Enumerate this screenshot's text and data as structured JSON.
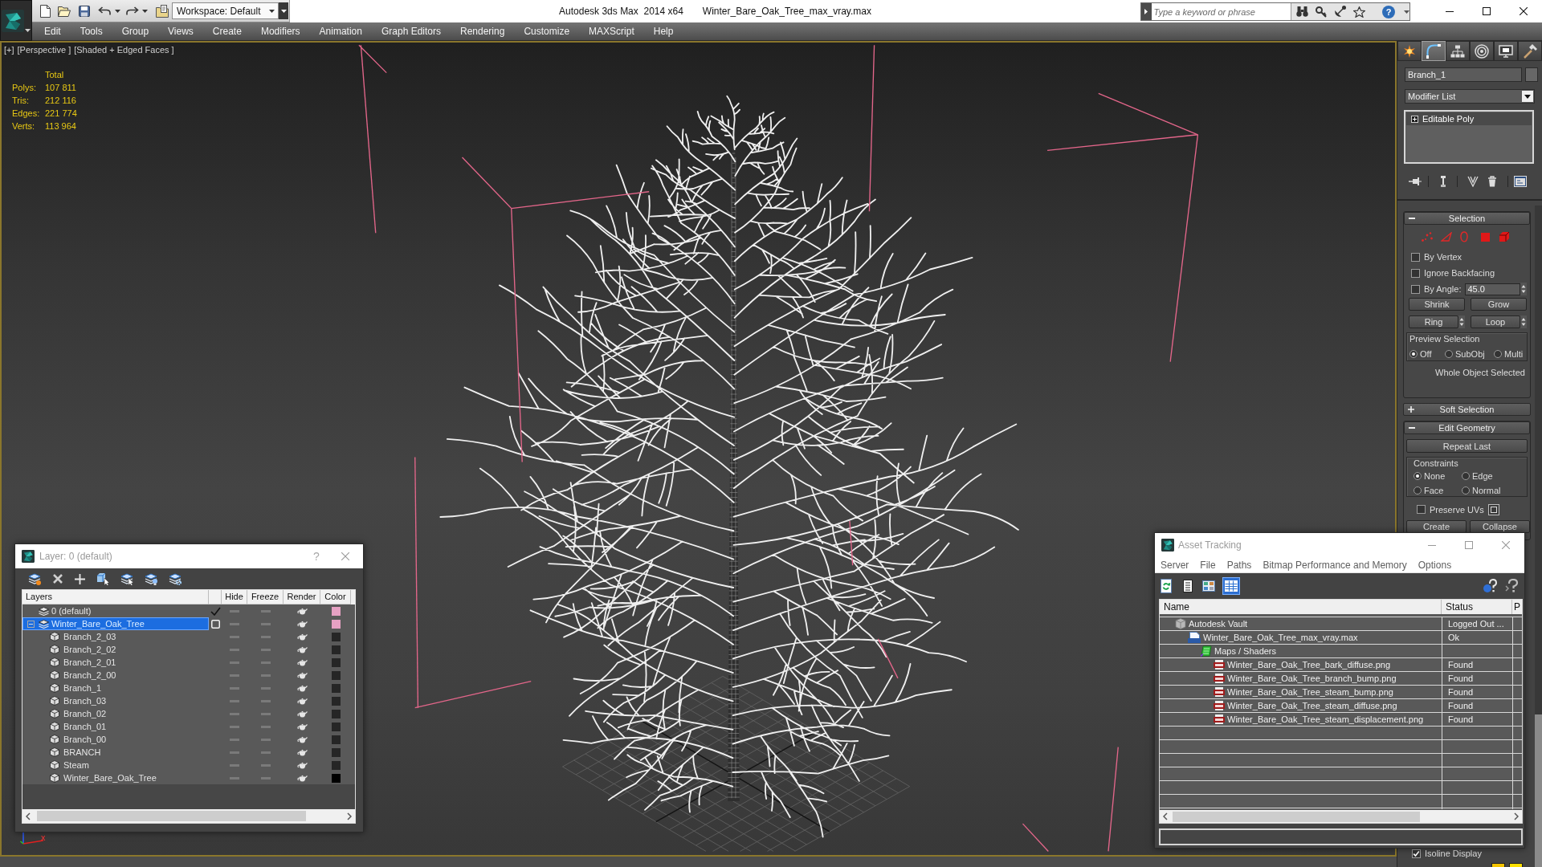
{
  "window": {
    "app_title": "Autodesk 3ds Max  2014 x64",
    "file_title": "Winter_Bare_Oak_Tree_max_vray.max"
  },
  "quick_access": {
    "workspace": "Workspace: Default"
  },
  "search": {
    "placeholder": "Type a keyword or phrase",
    "help": "?"
  },
  "menu": [
    "Edit",
    "Tools",
    "Group",
    "Views",
    "Create",
    "Modifiers",
    "Animation",
    "Graph Editors",
    "Rendering",
    "Customize",
    "MAXScript",
    "Help"
  ],
  "viewport": {
    "labels": [
      "[+]",
      "[Perspective ]",
      "[Shaded + Edged Faces ]"
    ],
    "stats": {
      "header": "Total",
      "rows": [
        {
          "label": "Polys:",
          "value": "107 811"
        },
        {
          "label": "Tris:",
          "value": "212 116"
        },
        {
          "label": "Edges:",
          "value": "221 774"
        },
        {
          "label": "Verts:",
          "value": "113 964"
        }
      ]
    },
    "axis_label": "x"
  },
  "command_panel": {
    "tabs": [
      {
        "selected": false
      },
      {
        "selected": true
      },
      {
        "selected": false
      },
      {
        "selected": false
      },
      {
        "selected": false
      },
      {
        "selected": false
      }
    ],
    "object_name": "Branch_1",
    "modifier_list": "Modifier List",
    "stack": [
      {
        "name": "Editable Poly",
        "expanded": false,
        "selected": false
      }
    ],
    "selection": {
      "title": "Selection",
      "expanded": true,
      "checkboxes": [
        {
          "label": "By Vertex",
          "checked": false
        },
        {
          "label": "Ignore Backfacing",
          "checked": false
        },
        {
          "label": "By Angle:",
          "checked": false,
          "value": "45.0"
        }
      ],
      "buttons": [
        "Shrink",
        "Grow"
      ],
      "spinner_buttons": [
        "Ring",
        "Loop"
      ],
      "preview": {
        "label": "Preview Selection",
        "options": [
          {
            "label": "Off",
            "selected": true
          },
          {
            "label": "SubObj",
            "selected": false
          },
          {
            "label": "Multi",
            "selected": false
          }
        ]
      },
      "status": "Whole Object Selected"
    },
    "soft_selection": {
      "title": "Soft Selection",
      "expanded": false
    },
    "edit_geometry": {
      "title": "Edit Geometry",
      "expanded": true,
      "button": "Repeat Last",
      "constraints": {
        "label": "Constraints",
        "options": [
          {
            "label": "None",
            "selected": true
          },
          {
            "label": "Edge",
            "selected": false
          },
          {
            "label": "Face",
            "selected": false
          },
          {
            "label": "Normal",
            "selected": false
          }
        ]
      },
      "preserve_uvs": {
        "label": "Preserve UVs",
        "checked": false
      },
      "buttons": [
        "Create",
        "Collapse"
      ]
    },
    "isoline": {
      "label": "Isoline Display",
      "checked": true
    }
  },
  "layer_dialog": {
    "title": "Layer: 0 (default)",
    "help": "?",
    "columns": [
      "Layers",
      "Hide",
      "Freeze",
      "Render",
      "Color"
    ],
    "layers": [
      {
        "kind": "layer",
        "name": "0 (default)",
        "selected": false,
        "current": true,
        "hidden": false,
        "frozen": false,
        "renderable": true,
        "color": "#e6a1c3"
      },
      {
        "kind": "layer",
        "name": "Winter_Bare_Oak_Tree",
        "selected": true,
        "current": false,
        "expanded": true,
        "hidden": false,
        "frozen": false,
        "renderable": true,
        "color": "#e6a1c3",
        "children": [
          {
            "kind": "object",
            "name": "Branch_2_03",
            "selected": false,
            "hidden": false,
            "frozen": false,
            "renderable": true,
            "color": "#262626"
          },
          {
            "kind": "object",
            "name": "Branch_2_02",
            "selected": false,
            "hidden": false,
            "frozen": false,
            "renderable": true,
            "color": "#262626"
          },
          {
            "kind": "object",
            "name": "Branch_2_01",
            "selected": false,
            "hidden": false,
            "frozen": false,
            "renderable": true,
            "color": "#262626"
          },
          {
            "kind": "object",
            "name": "Branch_2_00",
            "selected": false,
            "hidden": false,
            "frozen": false,
            "renderable": true,
            "color": "#262626"
          },
          {
            "kind": "object",
            "name": "Branch_1",
            "selected": false,
            "hidden": false,
            "frozen": false,
            "renderable": true,
            "color": "#262626"
          },
          {
            "kind": "object",
            "name": "Branch_03",
            "selected": false,
            "hidden": false,
            "frozen": false,
            "renderable": true,
            "color": "#262626"
          },
          {
            "kind": "object",
            "name": "Branch_02",
            "selected": false,
            "hidden": false,
            "frozen": false,
            "renderable": true,
            "color": "#262626"
          },
          {
            "kind": "object",
            "name": "Branch_01",
            "selected": false,
            "hidden": false,
            "frozen": false,
            "renderable": true,
            "color": "#262626"
          },
          {
            "kind": "object",
            "name": "Branch_00",
            "selected": false,
            "hidden": false,
            "frozen": false,
            "renderable": true,
            "color": "#262626"
          },
          {
            "kind": "object",
            "name": "BRANCH",
            "selected": false,
            "hidden": false,
            "frozen": false,
            "renderable": true,
            "color": "#262626"
          },
          {
            "kind": "object",
            "name": "Steam",
            "selected": false,
            "hidden": false,
            "frozen": false,
            "renderable": true,
            "color": "#262626"
          },
          {
            "kind": "object",
            "name": "Winter_Bare_Oak_Tree",
            "selected": false,
            "hidden": false,
            "frozen": false,
            "renderable": true,
            "color": "#000000"
          }
        ]
      }
    ]
  },
  "asset_tracking": {
    "title": "Asset Tracking",
    "menu": [
      "Server",
      "File",
      "Paths",
      "Bitmap Performance and Memory",
      "Options"
    ],
    "toolbar": [
      {
        "selected": false
      },
      {
        "selected": false
      },
      {
        "selected": false
      },
      {
        "selected": true
      }
    ],
    "columns": [
      "Name",
      "Status",
      "P"
    ],
    "assets": [
      {
        "kind": "vault",
        "name": "Autodesk Vault",
        "status": "Logged Out ...",
        "selected": false,
        "children": [
          {
            "kind": "max_file",
            "name": "Winter_Bare_Oak_Tree_max_vray.max",
            "status": "Ok",
            "selected": false,
            "children": [
              {
                "kind": "folder",
                "name": "Maps / Shaders",
                "selected": false,
                "children": [
                  {
                    "kind": "image",
                    "name": "Winter_Bare_Oak_Tree_bark_diffuse.png",
                    "status": "Found",
                    "selected": false
                  },
                  {
                    "kind": "image",
                    "name": "Winter_Bare_Oak_Tree_branch_bump.png",
                    "status": "Found",
                    "selected": false
                  },
                  {
                    "kind": "image",
                    "name": "Winter_Bare_Oak_Tree_steam_bump.png",
                    "status": "Found",
                    "selected": false
                  },
                  {
                    "kind": "image",
                    "name": "Winter_Bare_Oak_Tree_steam_diffuse.png",
                    "status": "Found",
                    "selected": false
                  },
                  {
                    "kind": "image",
                    "name": "Winter_Bare_Oak_Tree_steam_displacement.png",
                    "status": "Found",
                    "selected": false
                  }
                ]
              }
            ]
          }
        ]
      }
    ]
  }
}
